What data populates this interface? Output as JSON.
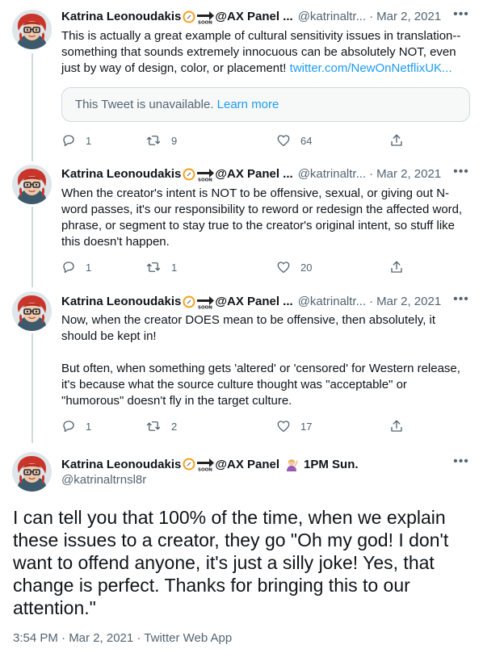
{
  "author": {
    "name": "Katrina Leonoudakis",
    "emoji_label": "SOON",
    "panel_text": "@AX Panel ...",
    "panel_text_full": "@AX Panel",
    "panel_suffix": "1PM Sun.",
    "handle_truncated": "@katrinaltr...",
    "handle_full": "@katrinaltrnsl8r"
  },
  "tweets": [
    {
      "date": "Mar 2, 2021",
      "text": "This is actually a great example of cultural sensitivity issues in translation--something that sounds extremely innocuous can be absolutely NOT, even just by way of design, color, or placement! ",
      "link": "twitter.com/NewOnNetflixUK...",
      "unavailable": "This Tweet is unavailable.",
      "learn_more": "Learn more",
      "replies": "1",
      "retweets": "9",
      "likes": "64"
    },
    {
      "date": "Mar 2, 2021",
      "text": "When the creator's intent is NOT to be offensive, sexual, or giving out N-word passes, it's our responsibility to reword or redesign the affected word, phrase, or segment to stay true to the creator's original intent, so stuff like this doesn't happen.",
      "replies": "1",
      "retweets": "1",
      "likes": "20"
    },
    {
      "date": "Mar 2, 2021",
      "text": "Now, when the creator DOES mean to be offensive, then absolutely, it should be kept in!\n\nBut often, when something gets 'altered' or 'censored' for Western release, it's because what the source culture thought was \"acceptable\" or \"humorous\" doesn't fly in the target culture.",
      "replies": "1",
      "retweets": "2",
      "likes": "17"
    }
  ],
  "main_tweet": {
    "text": "I can tell you that 100% of the time, when we explain these issues to a creator, they go \"Oh my god! I don't want to offend anyone, it's just a silly joke! Yes, that change is perfect. Thanks for bringing this to our attention.\"",
    "meta": "3:54 PM · Mar 2, 2021 · Twitter Web App"
  },
  "separator": "·",
  "icons": {
    "reply": "reply-icon",
    "retweet": "retweet-icon",
    "like": "heart-icon",
    "share": "share-icon",
    "more": "more-icon",
    "compass": "compass-emoji-icon",
    "soon": "soon-arrow-emoji-icon",
    "person": "person-gesturing-emoji-icon"
  },
  "colors": {
    "link": "#1d9bf0",
    "secondary": "#536471",
    "text": "#0f1419",
    "line": "#cfd9de"
  }
}
